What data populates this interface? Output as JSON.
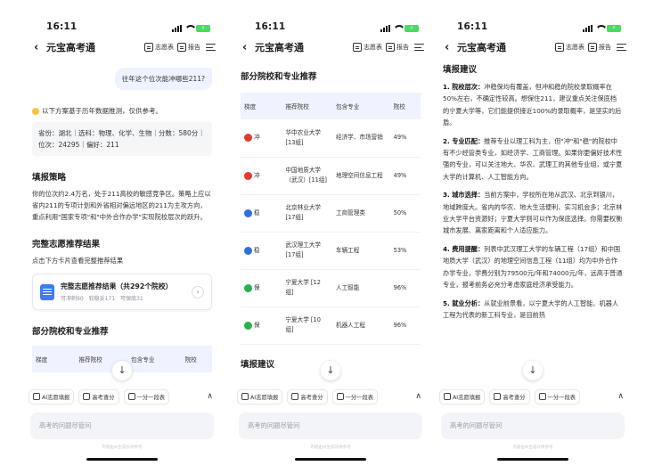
{
  "status": {
    "time": "16:11",
    "battery": "⚡"
  },
  "nav": {
    "back": "‹",
    "title": "元宝高考通",
    "btn1": "志愿表",
    "btn2": "报告"
  },
  "screen1": {
    "user_question": "往年这个位次能冲哪些211?",
    "tip": "以下方案基于历年数据推测，仅供参考。",
    "profile": "省份：湖北｜选科：物理、化学、生物｜分数：580分｜位次：24295｜偏好：211",
    "strategy_title": "填报策略",
    "strategy_text": "你的位次约2.4万名，处于211高校的敏感竞争区。策略上应以省内211的专项计划和外省相对偏远地区的211为主攻方向，重点利用\"国家专项\"和\"中外合作办学\"实现院校层次的跃升。",
    "result_title": "完整志愿推荐结果",
    "result_sub": "点击下方卡片查看完整推荐结果",
    "card_title": "完整志愿推荐结果（共292个院校）",
    "card_sub": "可冲刺90　较稳妥171　可保底31",
    "card_arrow": "›",
    "section_title": "部分院校和专业推荐",
    "headers": [
      "梯度",
      "推荐院校",
      "包含专业",
      "院校"
    ]
  },
  "screen2": {
    "section_title": "部分院校和专业推荐",
    "headers": [
      "梯度",
      "推荐院校",
      "包含专业",
      "院校"
    ],
    "rows": [
      {
        "tier": "冲",
        "color": "#e23b2e",
        "school": "华中农业大学 [13组]",
        "major": "经济学、市场营销",
        "rate": "49%"
      },
      {
        "tier": "冲",
        "color": "#e23b2e",
        "school": "中国地质大学（武汉）[11组]",
        "major": "地理空间信息工程",
        "rate": "49%"
      },
      {
        "tier": "稳",
        "color": "#2f6fe0",
        "school": "北京林业大学 [17组]",
        "major": "工商管理类",
        "rate": "50%"
      },
      {
        "tier": "稳",
        "color": "#2f6fe0",
        "school": "武汉理工大学 [17组]",
        "major": "车辆工程",
        "rate": "53%"
      },
      {
        "tier": "保",
        "color": "#27b14f",
        "school": "宁夏大学 [12组]",
        "major": "人工智能",
        "rate": "96%"
      },
      {
        "tier": "保",
        "color": "#27b14f",
        "school": "宁夏大学 [10组]",
        "major": "机器人工程",
        "rate": "96%"
      }
    ],
    "bottom_partial": "填报建议"
  },
  "screen3": {
    "title": "填报建议",
    "items": [
      {
        "head": "1. 院校层次：",
        "text": "冲稳保均有覆盖，但冲和稳的院校录取概率在50%左右，不确定性较高。想保住211，建议重点关注保底档的宁夏大学等，它们能提供接近100%的录取概率，是坚实的后盾。"
      },
      {
        "head": "2. 专业匹配：",
        "text": "推荐专业以理工科为主，但\"冲\"和\"稳\"的院校中有不少经管类专业，如经济学、工商管理。如果你更偏好技术性强的专业，可以关注地大、华农、武理工的其他专业组，或宁夏大学的计算机、人工智能方向。"
      },
      {
        "head": "3. 城市选择：",
        "text": "当前方案中，学校所在地从武汉、北京到银川，地域跨度大。省内的华农、地大生活便利、实习机会多；北京林业大学平台资源好；宁夏大学则可以作为保底选择。你需要权衡城市发展、离家距离和个人适应能力。"
      },
      {
        "head": "4. 费用提醒：",
        "text": "列表中武汉理工大学的车辆工程（17组）和中国地质大学（武汉）的地理空间信息工程（11组）均为中外合作办学专业，学费分别为79500元/年和74000元/年，远高于普通专业，报考前务必充分考虑家庭经济承受能力。"
      },
      {
        "head": "5. 就业分析：",
        "text": "从就业前景看，以宁夏大学的人工智能、机器人工程为代表的新工科专业，是目前热"
      }
    ]
  },
  "toolbar": {
    "chip1": "AI志愿填报",
    "chip2": "高考查分",
    "chip3": "一分一段表",
    "caret": "∧"
  },
  "scroll_down": "↓",
  "input_placeholder": "高考的问题尽管问",
  "disclaimer": "内容由AI生成仅供参考"
}
